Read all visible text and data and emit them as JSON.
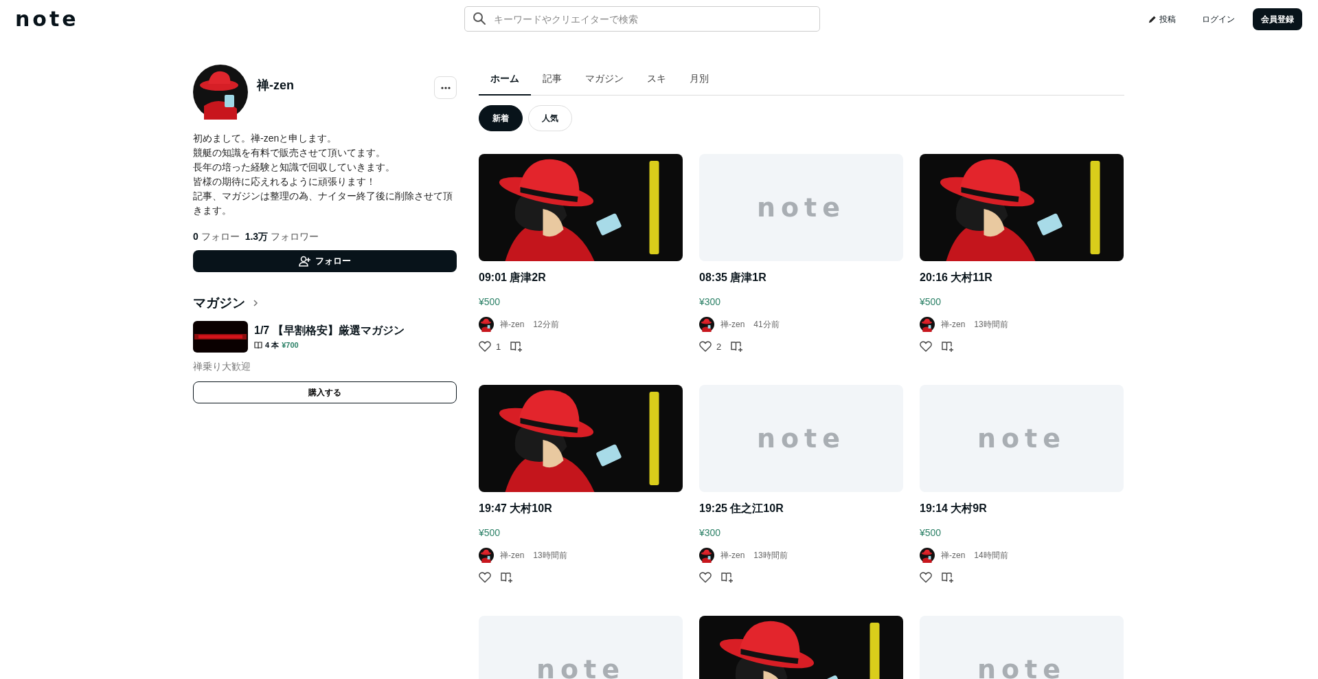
{
  "header": {
    "logo": "note",
    "search": {
      "placeholder": "キーワードやクリエイターで検索"
    },
    "post_link": "投稿",
    "login_link": "ログイン",
    "signup_button": "会員登録"
  },
  "profile": {
    "name": "禅-zen",
    "bio": [
      "初めまして。禅-zenと申します。",
      "競艇の知識を有料で販売させて頂いてます。",
      "長年の培った経験と知識で回収していきます。",
      "皆様の期待に応えれるように頑張ります！",
      "記事、マガジンは整理の為、ナイター終了後に削除させて頂きます。"
    ],
    "follow_count": "0",
    "follow_label": "フォロー",
    "follower_count": "1.3万",
    "follower_label": "フォロワー",
    "follow_button": "フォロー"
  },
  "magazine": {
    "heading": "マガジン",
    "title": "1/7 【早割格安】厳選マガジン",
    "count": "4 本",
    "price": "¥700",
    "description": "禅乗り大歓迎",
    "buy_button": "購入する"
  },
  "tabs": [
    {
      "label": "ホーム",
      "selected": true
    },
    {
      "label": "記事",
      "selected": false
    },
    {
      "label": "マガジン",
      "selected": false
    },
    {
      "label": "スキ",
      "selected": false
    },
    {
      "label": "月別",
      "selected": false
    }
  ],
  "filters": [
    {
      "label": "新着",
      "selected": true
    },
    {
      "label": "人気",
      "selected": false
    }
  ],
  "cards": [
    {
      "thumbnail": {
        "kind": "picture"
      },
      "title": "09:01 唐津2R",
      "price": "¥500",
      "author": "禅-zen",
      "time": "12分前",
      "likes": "1"
    },
    {
      "thumbnail": {
        "kind": "placeholder",
        "logo": "note"
      },
      "title": "08:35 唐津1R",
      "price": "¥300",
      "author": "禅-zen",
      "time": "41分前",
      "likes": "2"
    },
    {
      "thumbnail": {
        "kind": "picture"
      },
      "title": "20:16 大村11R",
      "price": "¥500",
      "author": "禅-zen",
      "time": "13時間前"
    },
    {
      "thumbnail": {
        "kind": "picture"
      },
      "title": "19:47 大村10R",
      "price": "¥500",
      "author": "禅-zen",
      "time": "13時間前"
    },
    {
      "thumbnail": {
        "kind": "placeholder",
        "logo": "note"
      },
      "title": "19:25 住之江10R",
      "price": "¥300",
      "author": "禅-zen",
      "time": "13時間前"
    },
    {
      "thumbnail": {
        "kind": "placeholder",
        "logo": "note"
      },
      "title": "19:14 大村9R",
      "price": "¥500",
      "author": "禅-zen",
      "time": "14時間前"
    },
    {
      "thumbnail": {
        "kind": "placeholder",
        "logo": "note"
      }
    },
    {
      "thumbnail": {
        "kind": "picture"
      }
    },
    {
      "thumbnail": {
        "kind": "placeholder",
        "logo": "note"
      }
    }
  ]
}
